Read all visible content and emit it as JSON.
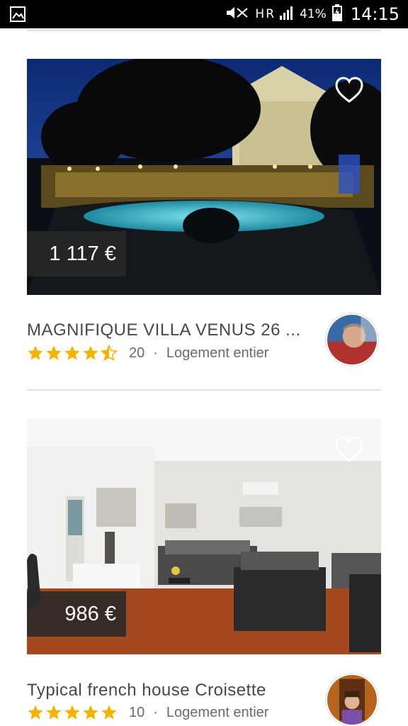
{
  "status_bar": {
    "battery_percent": "41%",
    "time": "14:15",
    "network_label": "H",
    "network_label_2": "R"
  },
  "listings": [
    {
      "price": "1 117 €",
      "title": "MAGNIFIQUE VILLA VENUS  26 ...",
      "rating": 4.5,
      "review_count": "20",
      "separator": "·",
      "room_type": "Logement entier",
      "favorite_icon": "heart-outline-icon"
    },
    {
      "price": "986 €",
      "title": "Typical french house Croisette",
      "rating": 5,
      "review_count": "10",
      "separator": "·",
      "room_type": "Logement entier",
      "favorite_icon": "heart-outline-icon"
    }
  ],
  "colors": {
    "star": "#f5b301",
    "title_text": "#484848",
    "meta_text": "#6b6b6b",
    "price_tag_bg": "#282828"
  }
}
